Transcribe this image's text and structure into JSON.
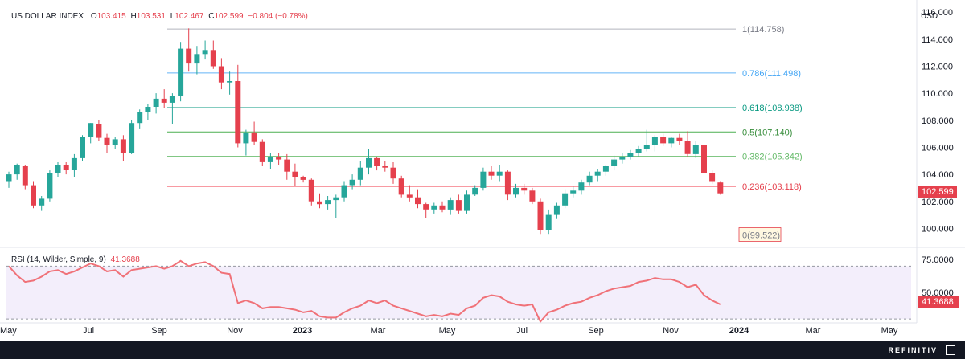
{
  "symbol": "US DOLLAR INDEX",
  "ohlc": {
    "o_label": "O",
    "o": "103.415",
    "h_label": "H",
    "h": "103.531",
    "l_label": "L",
    "l": "102.467",
    "c_label": "C",
    "c": "102.599",
    "change": "−0.804 (−0.78%)"
  },
  "currency": "USD",
  "last_price_label": "102.599",
  "rsi_legend": {
    "name": "RSI",
    "params": "(14, Wilder, Simple, 9)",
    "value": "41.3688"
  },
  "rsi_last_label": "41.3688",
  "brand": "REFINITIV",
  "colors": {
    "up": "#26a69a",
    "down": "#e5404d",
    "rsi_line": "#f07178",
    "rsi_band": "#f3eefb"
  },
  "chart_data": [
    {
      "type": "candlestick",
      "title": "US DOLLAR INDEX",
      "ylabel": "USD",
      "ylim": [
        98.6,
        116.9
      ],
      "y_ticks": [
        "100.000",
        "102.000",
        "104.000",
        "106.000",
        "108.000",
        "110.000",
        "112.000",
        "114.000",
        "116.000"
      ],
      "x_ticks": [
        "May",
        "Jul",
        "Sep",
        "Nov",
        "2023",
        "Mar",
        "May",
        "Jul",
        "Sep",
        "Nov",
        "2024",
        "Mar",
        "May"
      ],
      "candles": [
        {
          "o": 103.5,
          "h": 104.2,
          "l": 103.0,
          "c": 104.0
        },
        {
          "o": 104.0,
          "h": 104.8,
          "l": 103.6,
          "c": 104.7
        },
        {
          "o": 104.6,
          "h": 104.7,
          "l": 102.9,
          "c": 103.2
        },
        {
          "o": 103.2,
          "h": 103.5,
          "l": 101.5,
          "c": 101.7
        },
        {
          "o": 101.7,
          "h": 102.4,
          "l": 101.3,
          "c": 102.2
        },
        {
          "o": 102.2,
          "h": 104.3,
          "l": 102.0,
          "c": 104.1
        },
        {
          "o": 104.1,
          "h": 104.9,
          "l": 103.8,
          "c": 104.7
        },
        {
          "o": 104.7,
          "h": 104.9,
          "l": 104.0,
          "c": 104.3
        },
        {
          "o": 104.3,
          "h": 105.5,
          "l": 103.8,
          "c": 105.2
        },
        {
          "o": 105.2,
          "h": 106.9,
          "l": 105.0,
          "c": 106.8
        },
        {
          "o": 106.8,
          "h": 107.8,
          "l": 106.3,
          "c": 107.8
        },
        {
          "o": 107.7,
          "h": 108.0,
          "l": 106.5,
          "c": 106.7
        },
        {
          "o": 106.7,
          "h": 107.0,
          "l": 105.6,
          "c": 106.2
        },
        {
          "o": 106.2,
          "h": 106.8,
          "l": 105.9,
          "c": 106.6
        },
        {
          "o": 106.6,
          "h": 106.9,
          "l": 105.0,
          "c": 105.6
        },
        {
          "o": 105.6,
          "h": 108.0,
          "l": 105.5,
          "c": 107.8
        },
        {
          "o": 107.8,
          "h": 108.8,
          "l": 107.4,
          "c": 108.6
        },
        {
          "o": 108.6,
          "h": 109.2,
          "l": 108.0,
          "c": 109.0
        },
        {
          "o": 109.0,
          "h": 110.0,
          "l": 108.5,
          "c": 109.6
        },
        {
          "o": 109.6,
          "h": 110.3,
          "l": 108.9,
          "c": 109.3
        },
        {
          "o": 109.3,
          "h": 110.0,
          "l": 107.7,
          "c": 109.8
        },
        {
          "o": 109.8,
          "h": 113.8,
          "l": 109.4,
          "c": 113.3
        },
        {
          "o": 113.3,
          "h": 114.8,
          "l": 111.6,
          "c": 112.2
        },
        {
          "o": 112.2,
          "h": 113.5,
          "l": 111.4,
          "c": 112.9
        },
        {
          "o": 112.9,
          "h": 113.9,
          "l": 112.5,
          "c": 113.2
        },
        {
          "o": 113.2,
          "h": 113.9,
          "l": 111.8,
          "c": 112.0
        },
        {
          "o": 112.0,
          "h": 112.6,
          "l": 110.3,
          "c": 110.8
        },
        {
          "o": 110.8,
          "h": 111.6,
          "l": 109.9,
          "c": 110.9
        },
        {
          "o": 110.9,
          "h": 112.1,
          "l": 106.0,
          "c": 106.3
        },
        {
          "o": 106.3,
          "h": 107.3,
          "l": 105.4,
          "c": 107.1
        },
        {
          "o": 107.1,
          "h": 107.9,
          "l": 106.2,
          "c": 106.4
        },
        {
          "o": 106.4,
          "h": 106.6,
          "l": 104.6,
          "c": 104.9
        },
        {
          "o": 104.9,
          "h": 105.6,
          "l": 104.4,
          "c": 105.3
        },
        {
          "o": 105.3,
          "h": 105.6,
          "l": 104.7,
          "c": 105.1
        },
        {
          "o": 105.1,
          "h": 105.5,
          "l": 103.6,
          "c": 104.2
        },
        {
          "o": 104.2,
          "h": 104.8,
          "l": 103.1,
          "c": 103.8
        },
        {
          "o": 103.8,
          "h": 103.9,
          "l": 103.4,
          "c": 103.6
        },
        {
          "o": 103.6,
          "h": 103.7,
          "l": 101.7,
          "c": 102.0
        },
        {
          "o": 102.0,
          "h": 102.6,
          "l": 101.5,
          "c": 101.8
        },
        {
          "o": 101.8,
          "h": 102.4,
          "l": 101.4,
          "c": 102.1
        },
        {
          "o": 102.1,
          "h": 102.5,
          "l": 100.8,
          "c": 102.3
        },
        {
          "o": 102.3,
          "h": 103.5,
          "l": 102.0,
          "c": 103.2
        },
        {
          "o": 103.2,
          "h": 104.0,
          "l": 102.9,
          "c": 103.6
        },
        {
          "o": 103.6,
          "h": 105.0,
          "l": 103.2,
          "c": 104.5
        },
        {
          "o": 104.5,
          "h": 105.9,
          "l": 104.0,
          "c": 105.2
        },
        {
          "o": 105.2,
          "h": 105.3,
          "l": 104.3,
          "c": 104.6
        },
        {
          "o": 104.6,
          "h": 105.0,
          "l": 104.2,
          "c": 104.5
        },
        {
          "o": 104.5,
          "h": 104.9,
          "l": 103.3,
          "c": 103.7
        },
        {
          "o": 103.7,
          "h": 103.9,
          "l": 102.3,
          "c": 102.5
        },
        {
          "o": 102.5,
          "h": 103.2,
          "l": 102.0,
          "c": 102.3
        },
        {
          "o": 102.3,
          "h": 102.9,
          "l": 101.5,
          "c": 101.8
        },
        {
          "o": 101.8,
          "h": 101.9,
          "l": 100.8,
          "c": 101.4
        },
        {
          "o": 101.4,
          "h": 101.9,
          "l": 101.1,
          "c": 101.7
        },
        {
          "o": 101.7,
          "h": 102.0,
          "l": 101.2,
          "c": 101.4
        },
        {
          "o": 101.4,
          "h": 102.3,
          "l": 101.0,
          "c": 102.1
        },
        {
          "o": 102.1,
          "h": 102.5,
          "l": 101.1,
          "c": 101.3
        },
        {
          "o": 101.3,
          "h": 102.8,
          "l": 101.1,
          "c": 102.5
        },
        {
          "o": 102.5,
          "h": 103.2,
          "l": 102.4,
          "c": 103.0
        },
        {
          "o": 103.0,
          "h": 104.5,
          "l": 102.8,
          "c": 104.2
        },
        {
          "o": 104.2,
          "h": 104.6,
          "l": 103.6,
          "c": 103.9
        },
        {
          "o": 103.9,
          "h": 104.7,
          "l": 103.5,
          "c": 104.2
        },
        {
          "o": 104.2,
          "h": 104.3,
          "l": 102.1,
          "c": 102.5
        },
        {
          "o": 102.5,
          "h": 103.3,
          "l": 102.3,
          "c": 103.0
        },
        {
          "o": 103.0,
          "h": 103.3,
          "l": 102.5,
          "c": 102.8
        },
        {
          "o": 102.8,
          "h": 103.0,
          "l": 101.8,
          "c": 102.0
        },
        {
          "o": 102.0,
          "h": 102.2,
          "l": 99.6,
          "c": 99.9
        },
        {
          "o": 99.9,
          "h": 101.4,
          "l": 99.6,
          "c": 101.0
        },
        {
          "o": 101.0,
          "h": 101.9,
          "l": 100.7,
          "c": 101.7
        },
        {
          "o": 101.7,
          "h": 102.9,
          "l": 101.5,
          "c": 102.6
        },
        {
          "o": 102.6,
          "h": 103.1,
          "l": 102.3,
          "c": 102.8
        },
        {
          "o": 102.8,
          "h": 103.6,
          "l": 102.5,
          "c": 103.4
        },
        {
          "o": 103.4,
          "h": 104.2,
          "l": 103.2,
          "c": 103.9
        },
        {
          "o": 103.9,
          "h": 104.4,
          "l": 103.5,
          "c": 104.2
        },
        {
          "o": 104.2,
          "h": 104.7,
          "l": 103.9,
          "c": 104.6
        },
        {
          "o": 104.6,
          "h": 105.4,
          "l": 104.3,
          "c": 105.1
        },
        {
          "o": 105.1,
          "h": 105.6,
          "l": 104.8,
          "c": 105.3
        },
        {
          "o": 105.3,
          "h": 105.8,
          "l": 105.1,
          "c": 105.6
        },
        {
          "o": 105.6,
          "h": 106.1,
          "l": 105.3,
          "c": 105.9
        },
        {
          "o": 105.9,
          "h": 107.3,
          "l": 105.7,
          "c": 106.2
        },
        {
          "o": 106.2,
          "h": 106.9,
          "l": 105.7,
          "c": 106.8
        },
        {
          "o": 106.8,
          "h": 107.0,
          "l": 106.1,
          "c": 106.3
        },
        {
          "o": 106.3,
          "h": 106.8,
          "l": 106.0,
          "c": 106.7
        },
        {
          "o": 106.7,
          "h": 107.0,
          "l": 106.2,
          "c": 106.5
        },
        {
          "o": 106.5,
          "h": 107.2,
          "l": 105.3,
          "c": 105.5
        },
        {
          "o": 105.5,
          "h": 106.5,
          "l": 105.2,
          "c": 106.2
        },
        {
          "o": 106.2,
          "h": 106.3,
          "l": 103.9,
          "c": 104.1
        },
        {
          "o": 104.1,
          "h": 104.3,
          "l": 103.3,
          "c": 103.5
        },
        {
          "o": 103.4,
          "h": 103.5,
          "l": 102.5,
          "c": 102.6
        }
      ],
      "fibonacci": [
        {
          "label": "1(114.758)",
          "value": 114.758
        },
        {
          "label": "0.786(111.498)",
          "value": 111.498
        },
        {
          "label": "0.618(108.938)",
          "value": 108.938
        },
        {
          "label": "0.5(107.140)",
          "value": 107.14
        },
        {
          "label": "0.382(105.342)",
          "value": 105.342
        },
        {
          "label": "0.236(103.118)",
          "value": 103.118
        },
        {
          "label": "0(99.522)",
          "value": 99.522
        }
      ],
      "last_price": 102.599
    },
    {
      "type": "line",
      "title": "RSI (14, Wilder, Simple, 9)",
      "ylim": [
        27,
        83
      ],
      "y_ticks": [
        "75.0000",
        "50.0000"
      ],
      "band": [
        30,
        70
      ],
      "series": [
        {
          "name": "RSI",
          "values": [
            70,
            63,
            58,
            59,
            62,
            66,
            67,
            64,
            66,
            69,
            72,
            70,
            66,
            67,
            62,
            67,
            68,
            69,
            70,
            68,
            70,
            74,
            70,
            72,
            73,
            70,
            65,
            64,
            42,
            44,
            42,
            38,
            39,
            39,
            38,
            37,
            35,
            36,
            32,
            31,
            31,
            35,
            38,
            40,
            44,
            42,
            44,
            40,
            38,
            36,
            34,
            32,
            33,
            32,
            34,
            33,
            38,
            40,
            46,
            48,
            47,
            43,
            41,
            40,
            41,
            28,
            35,
            37,
            40,
            42,
            43,
            46,
            48,
            51,
            53,
            54,
            55,
            58,
            59,
            61,
            60,
            60,
            58,
            54,
            56,
            48,
            44,
            41
          ]
        }
      ],
      "last_value": 41.3688
    }
  ]
}
